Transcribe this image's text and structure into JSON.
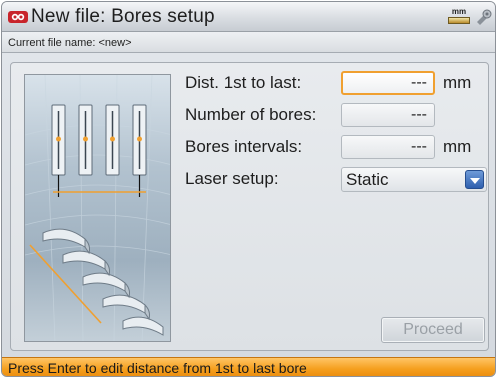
{
  "window": {
    "title": "New file: Bores setup",
    "units_badge": "mm",
    "icons": [
      "app-logo-icon",
      "units-mm-icon",
      "settings-icon"
    ]
  },
  "file_bar": {
    "text": "Current file name: <new>"
  },
  "form": {
    "dist_first_last": {
      "label": "Dist. 1st to last:",
      "value": "---",
      "unit": "mm"
    },
    "number_of_bores": {
      "label": "Number of bores:",
      "value": "---"
    },
    "bores_intervals": {
      "label": "Bores intervals:",
      "value": "---",
      "unit": "mm"
    },
    "laser_setup": {
      "label": "Laser setup:",
      "value": "Static"
    }
  },
  "proceed_button": {
    "label": "Proceed"
  },
  "status_bar": {
    "text": "Press Enter to edit distance from 1st to last bore"
  },
  "colors": {
    "focus_border": "#f0a030",
    "status_bar": "#f59f1e",
    "dropdown_arrow": "#2e5fae",
    "guide_line": "#f0a030"
  }
}
